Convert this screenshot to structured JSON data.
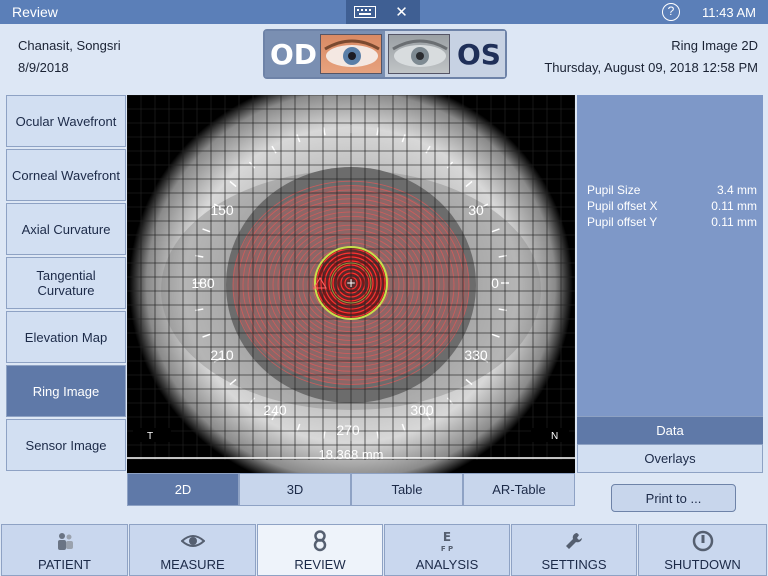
{
  "titlebar": {
    "title": "Review",
    "keyboard_icon": "keyboard-icon",
    "close_icon": "close-icon",
    "help_label": "?",
    "time": "11:43 AM"
  },
  "patient": {
    "name": "Chanasit, Songsri",
    "date": "8/9/2018"
  },
  "eye_selector": {
    "od": "OD",
    "os": "OS",
    "selected": "OD"
  },
  "view": {
    "name": "Ring Image 2D",
    "datetime": "Thursday, August 09, 2018 12:58 PM"
  },
  "left_nav": [
    {
      "label": "Ocular Wavefront",
      "active": false
    },
    {
      "label": "Corneal Wavefront",
      "active": false
    },
    {
      "label": "Axial Curvature",
      "active": false
    },
    {
      "label": "Tangential Curvature",
      "active": false
    },
    {
      "label": "Elevation Map",
      "active": false
    },
    {
      "label": "Ring Image",
      "active": true
    },
    {
      "label": "Sensor Image",
      "active": false
    }
  ],
  "image": {
    "angle_labels": {
      "a0": "0",
      "a30": "30",
      "a150": "150",
      "a180": "180",
      "a210": "210",
      "a240": "240",
      "a270": "270",
      "a300": "300",
      "a330": "330"
    },
    "temporal_marker": "T",
    "nasal_marker": "N",
    "scale_label": "18.368 mm"
  },
  "metrics": [
    {
      "label": "Pupil Size",
      "value": "3.4 mm"
    },
    {
      "label": "Pupil offset X",
      "value": "0.11 mm"
    },
    {
      "label": "Pupil offset Y",
      "value": "0.11 mm"
    }
  ],
  "right_tabs": {
    "data": "Data",
    "overlays": "Overlays",
    "selected": "Data"
  },
  "view_tabs": [
    {
      "label": "2D",
      "active": true
    },
    {
      "label": "3D",
      "active": false
    },
    {
      "label": "Table",
      "active": false
    },
    {
      "label": "AR-Table",
      "active": false
    }
  ],
  "print_label": "Print to ...",
  "bottom_nav": [
    {
      "label": "PATIENT",
      "icon": "patient-icon",
      "active": false
    },
    {
      "label": "MEASURE",
      "icon": "eye-icon",
      "active": false
    },
    {
      "label": "REVIEW",
      "icon": "review-icon",
      "active": true
    },
    {
      "label": "ANALYSIS",
      "icon": "eye-chart-icon",
      "active": false
    },
    {
      "label": "SETTINGS",
      "icon": "wrench-icon",
      "active": false
    },
    {
      "label": "SHUTDOWN",
      "icon": "power-icon",
      "active": false
    }
  ],
  "colors": {
    "accent": "#5f79a8",
    "titlebar": "#5b7fb8",
    "ring_overlay": "#e05a5a",
    "pupil_ring": "#c8e04a"
  }
}
